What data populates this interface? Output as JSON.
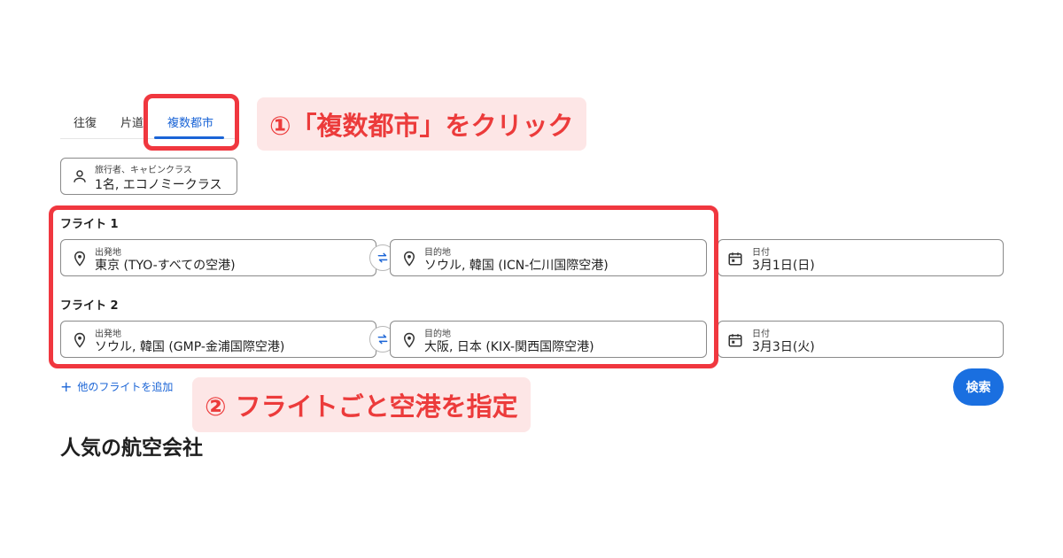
{
  "tabs": [
    {
      "label": "往復"
    },
    {
      "label": "片道"
    },
    {
      "label": "複数都市"
    }
  ],
  "callouts": {
    "step1": "①「複数都市」をクリック",
    "step2": "② フライトごと空港を指定"
  },
  "traveler": {
    "label": "旅行者、キャビンクラス",
    "value": "1名, エコノミークラス"
  },
  "flights": [
    {
      "title": "フライト 1",
      "origin": {
        "label": "出発地",
        "value": "東京 (TYO-すべての空港)"
      },
      "destination": {
        "label": "目的地",
        "value": "ソウル, 韓国 (ICN-仁川国際空港)"
      },
      "date": {
        "label": "日付",
        "value": "3月1日(日)"
      }
    },
    {
      "title": "フライト 2",
      "origin": {
        "label": "出発地",
        "value": "ソウル, 韓国 (GMP-金浦国際空港)"
      },
      "destination": {
        "label": "目的地",
        "value": "大阪, 日本 (KIX-関西国際空港)"
      },
      "date": {
        "label": "日付",
        "value": "3月3日(火)"
      }
    }
  ],
  "add_flight": "他のフライトを追加",
  "search_button": "検索",
  "section_title": "人気の航空会社",
  "colors": {
    "accent": "#1a64d6",
    "highlight_border": "#f0373f",
    "callout_bg": "#fde6e6",
    "callout_text": "#ec3b3b"
  },
  "icons": {
    "traveler": "person-icon",
    "location": "location-pin-icon",
    "swap": "swap-icon",
    "date": "calendar-icon",
    "add": "plus-icon"
  }
}
